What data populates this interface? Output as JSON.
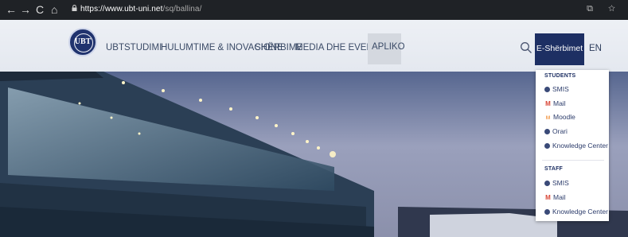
{
  "browser": {
    "nav_back": "←",
    "nav_forward": "→",
    "nav_reload": "C",
    "nav_home": "⌂",
    "url_host": "https://www.ubt-uni.net",
    "url_path": "/sq/ballina/",
    "ext_icons": "⧉ ☆"
  },
  "header": {
    "logo_text": "UBT",
    "nav": [
      "UBT",
      "STUDIMI",
      "HULUMTIME & INOVACIONE",
      "SHËRBIME",
      "MEDIA DHE EVENTE"
    ],
    "apliko": "APLIKO",
    "eservices": "E-Shërbimet",
    "lang": "EN"
  },
  "dropdown": {
    "students_heading": "STUDENTS",
    "students": [
      {
        "label": "SMIS",
        "icon": "smis-icon"
      },
      {
        "label": "Mail",
        "icon": "mail-icon"
      },
      {
        "label": "Moodle",
        "icon": "moodle-icon"
      },
      {
        "label": "Orari",
        "icon": "orari-icon"
      },
      {
        "label": "Knowledge Center",
        "icon": "knowledge-icon"
      }
    ],
    "staff_heading": "STAFF",
    "staff": [
      {
        "label": "SMIS",
        "icon": "smis-icon"
      },
      {
        "label": "Mail",
        "icon": "mail-icon"
      },
      {
        "label": "Knowledge Center",
        "icon": "knowledge-icon"
      }
    ]
  },
  "colors": {
    "brand_navy": "#1d2f63",
    "header_bg": "#eceff4",
    "chrome_bg": "#1f2226"
  }
}
